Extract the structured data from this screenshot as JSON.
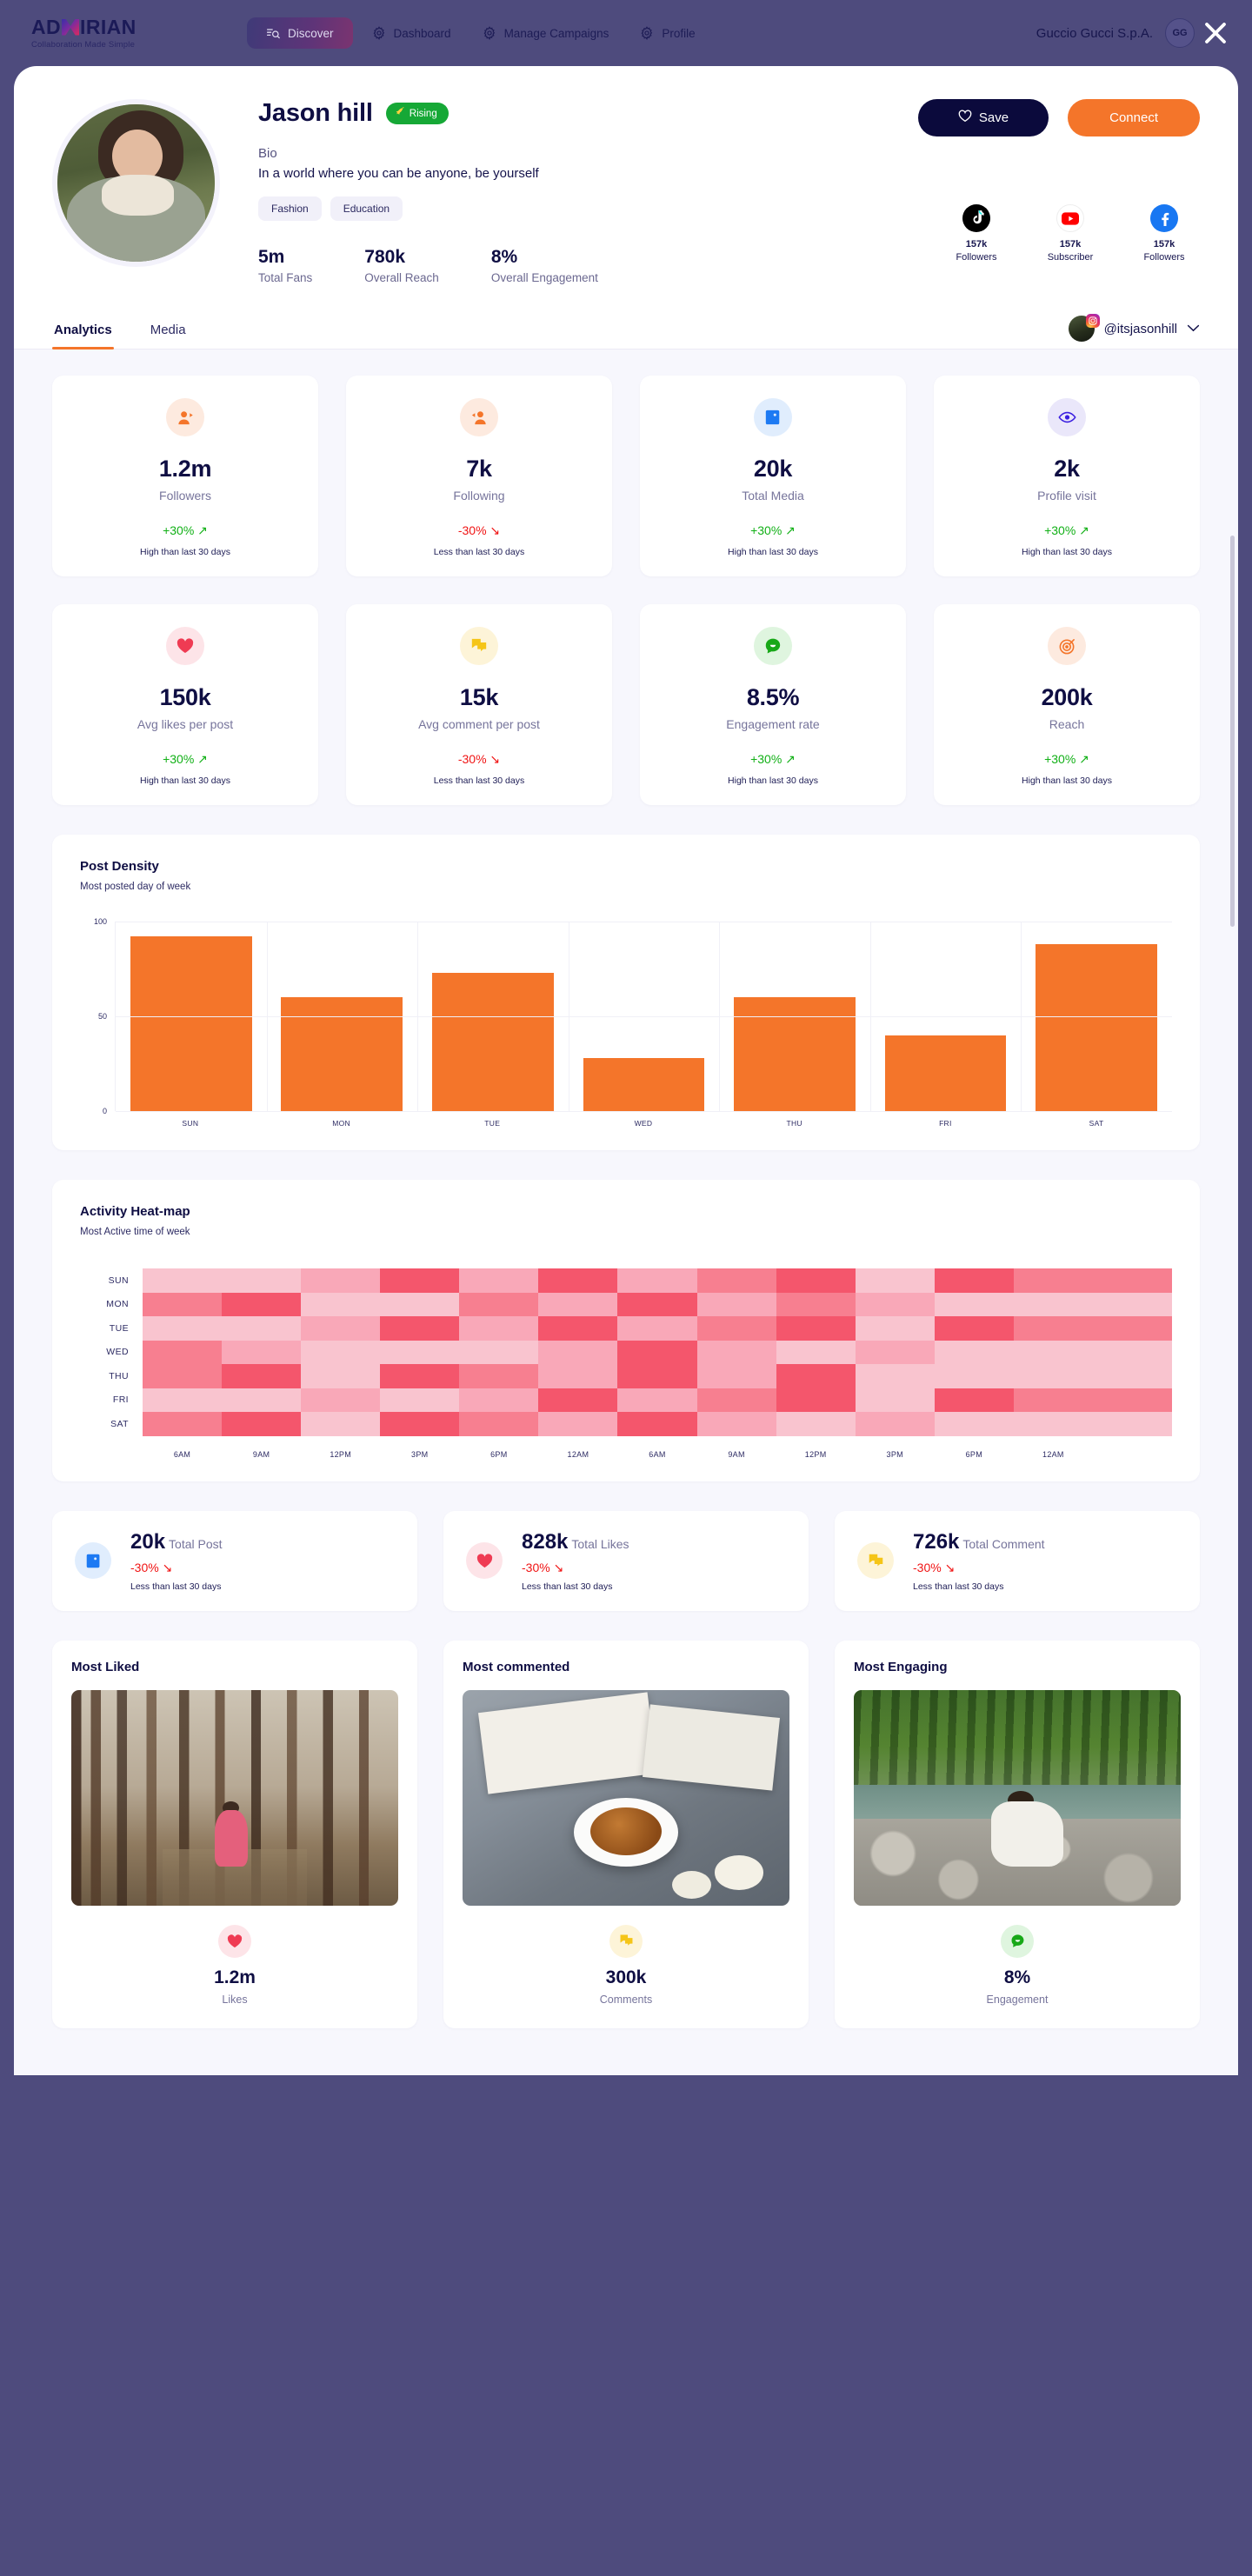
{
  "topnav": {
    "logo_text_1": "AD",
    "logo_text_2": "IRIAN",
    "logo_tagline": "Collaboration Made Simple",
    "items": [
      {
        "label": "Discover",
        "icon": "discover-icon",
        "active": true
      },
      {
        "label": "Dashboard",
        "icon": "gear-icon",
        "active": false
      },
      {
        "label": "Manage Campaigns",
        "icon": "gear-icon",
        "active": false
      },
      {
        "label": "Profile",
        "icon": "gear-icon",
        "active": false
      }
    ],
    "org_name": "Guccio Gucci S.p.A.",
    "org_avatar_text": "GG",
    "close_label": "close-icon"
  },
  "profile": {
    "name": "Jason hill",
    "badge": "Rising",
    "bio_label": "Bio",
    "bio_text": "In a world where you can be anyone, be yourself",
    "tags": [
      "Fashion",
      "Education"
    ],
    "stats": [
      {
        "value": "5m",
        "label": "Total Fans"
      },
      {
        "value": "780k",
        "label": "Overall Reach"
      },
      {
        "value": "8%",
        "label": "Overall Engagement"
      }
    ],
    "save_label": "Save",
    "connect_label": "Connect",
    "socials": [
      {
        "network": "tiktok",
        "count": "157k",
        "caption": "Followers"
      },
      {
        "network": "youtube",
        "count": "157k",
        "caption": "Subscriber"
      },
      {
        "network": "facebook",
        "count": "157k",
        "caption": "Followers"
      }
    ]
  },
  "tabs": {
    "items": [
      {
        "label": "Analytics",
        "active": true
      },
      {
        "label": "Media",
        "active": false
      }
    ],
    "account_handle": "@itsjasonhill"
  },
  "stat_cards_row1": [
    {
      "icon": "followers-icon",
      "icon_bg": "#fdeadf",
      "icon_color": "#f4752a",
      "value": "1.2m",
      "label": "Followers",
      "delta": "+30%",
      "direction": "up",
      "note": "High than last 30 days"
    },
    {
      "icon": "following-icon",
      "icon_bg": "#fdeadf",
      "icon_color": "#f4752a",
      "value": "7k",
      "label": "Following",
      "delta": "-30%",
      "direction": "down",
      "note": "Less than last 30 days"
    },
    {
      "icon": "media-icon",
      "icon_bg": "#e0edfd",
      "icon_color": "#1d7af3",
      "value": "20k",
      "label": "Total Media",
      "delta": "+30%",
      "direction": "up",
      "note": "High than last 30 days"
    },
    {
      "icon": "eye-icon",
      "icon_bg": "#eae7fa",
      "icon_color": "#3a1ee0",
      "value": "2k",
      "label": "Profile visit",
      "delta": "+30%",
      "direction": "up",
      "note": "High than last 30 days"
    }
  ],
  "stat_cards_row2": [
    {
      "icon": "heart-icon",
      "icon_bg": "#fde4e8",
      "icon_color": "#ef3b53",
      "value": "150k",
      "label": "Avg likes per post",
      "delta": "+30%",
      "direction": "up",
      "note": "High than last 30 days"
    },
    {
      "icon": "comment-icon",
      "icon_bg": "#fdf4d8",
      "icon_color": "#f5c518",
      "value": "15k",
      "label": "Avg comment per post",
      "delta": "-30%",
      "direction": "down",
      "note": "Less than last 30 days"
    },
    {
      "icon": "engagement-icon",
      "icon_bg": "#dff5df",
      "icon_color": "#18a818",
      "value": "8.5%",
      "label": "Engagement rate",
      "delta": "+30%",
      "direction": "up",
      "note": "High than last 30 days"
    },
    {
      "icon": "target-icon",
      "icon_bg": "#fdeadf",
      "icon_color": "#f4752a",
      "value": "200k",
      "label": "Reach",
      "delta": "+30%",
      "direction": "up",
      "note": "High than last 30 days"
    }
  ],
  "post_density": {
    "title": "Post Density",
    "subtitle": "Most posted day of week"
  },
  "heatmap": {
    "title": "Activity Heat-map",
    "subtitle": "Most Active time of week"
  },
  "totals": [
    {
      "icon": "media-icon",
      "icon_bg": "#e0edfd",
      "icon_color": "#1d7af3",
      "value": "20k",
      "label": "Total Post",
      "delta": "-30%",
      "note": "Less than last 30 days"
    },
    {
      "icon": "heart-icon",
      "icon_bg": "#fde4e8",
      "icon_color": "#ef3b53",
      "value": "828k",
      "label": "Total Likes",
      "delta": "-30%",
      "note": "Less than last 30 days"
    },
    {
      "icon": "comment-icon",
      "icon_bg": "#fdf4d8",
      "icon_color": "#f5c518",
      "value": "726k",
      "label": "Total Comment",
      "delta": "-30%",
      "note": "Less than last 30 days"
    }
  ],
  "media_cards": [
    {
      "title": "Most Liked",
      "photo": "forest",
      "icon": "heart-icon",
      "icon_bg": "#fde4e8",
      "icon_color": "#ef3b53",
      "value": "1.2m",
      "label": "Likes"
    },
    {
      "title": "Most commented",
      "photo": "coffee",
      "icon": "comment-icon",
      "icon_bg": "#fdf4d8",
      "icon_color": "#f5c518",
      "value": "300k",
      "label": "Comments"
    },
    {
      "title": "Most Engaging",
      "photo": "river",
      "icon": "engagement-icon",
      "icon_bg": "#dff5df",
      "icon_color": "#18a818",
      "value": "8%",
      "label": "Engagement"
    }
  ],
  "colors": {
    "accent_orange": "#f4752a",
    "navy": "#0f0e43",
    "nav_bg": "#4e4b7d",
    "green": "#11b016",
    "red": "#f01414",
    "heat_scale": [
      "#f9c4cf",
      "#f9a8b8",
      "#f77f90",
      "#f4566c",
      "#ea3249"
    ]
  },
  "chart_data": [
    {
      "type": "bar",
      "title": "Post Density",
      "subtitle": "Most posted day of week",
      "xlabel": "",
      "ylabel": "",
      "categories": [
        "SUN",
        "MON",
        "TUE",
        "WED",
        "THU",
        "FRI",
        "SAT"
      ],
      "values": [
        92,
        60,
        73,
        28,
        60,
        40,
        88
      ],
      "ylim": [
        0,
        100
      ],
      "yticks": [
        0,
        50,
        100
      ],
      "grid": true,
      "color": "#f4752a",
      "legend": "none"
    },
    {
      "type": "heatmap",
      "title": "Activity Heat-map",
      "subtitle": "Most Active time of week",
      "rows": [
        "SUN",
        "MON",
        "TUE",
        "WED",
        "THU",
        "FRI",
        "SAT"
      ],
      "columns": [
        "6AM",
        "9AM",
        "12PM",
        "3PM",
        "6PM",
        "12AM",
        "6AM",
        "9AM",
        "12PM",
        "3PM",
        "6PM",
        "12AM",
        ""
      ],
      "values": [
        [
          1,
          1,
          2,
          4,
          2,
          4,
          2,
          3,
          4,
          1,
          4,
          3,
          3
        ],
        [
          3,
          4,
          1,
          1,
          3,
          2,
          4,
          2,
          3,
          2,
          1,
          1,
          1
        ],
        [
          1,
          1,
          2,
          4,
          2,
          4,
          2,
          3,
          4,
          1,
          4,
          3,
          3
        ],
        [
          3,
          2,
          1,
          1,
          1,
          2,
          4,
          2,
          1,
          2,
          1,
          1,
          1
        ],
        [
          3,
          4,
          1,
          4,
          3,
          2,
          4,
          2,
          4,
          1,
          1,
          1,
          1
        ],
        [
          1,
          1,
          2,
          1,
          2,
          4,
          2,
          3,
          4,
          1,
          4,
          3,
          3
        ],
        [
          3,
          4,
          1,
          4,
          3,
          2,
          4,
          2,
          1,
          2,
          1,
          1,
          1
        ]
      ],
      "scale_min": 1,
      "scale_max": 5,
      "colorscale": [
        "#f9c4cf",
        "#f9a8b8",
        "#f77f90",
        "#f4566c",
        "#ea3249"
      ],
      "legend": "none"
    }
  ]
}
